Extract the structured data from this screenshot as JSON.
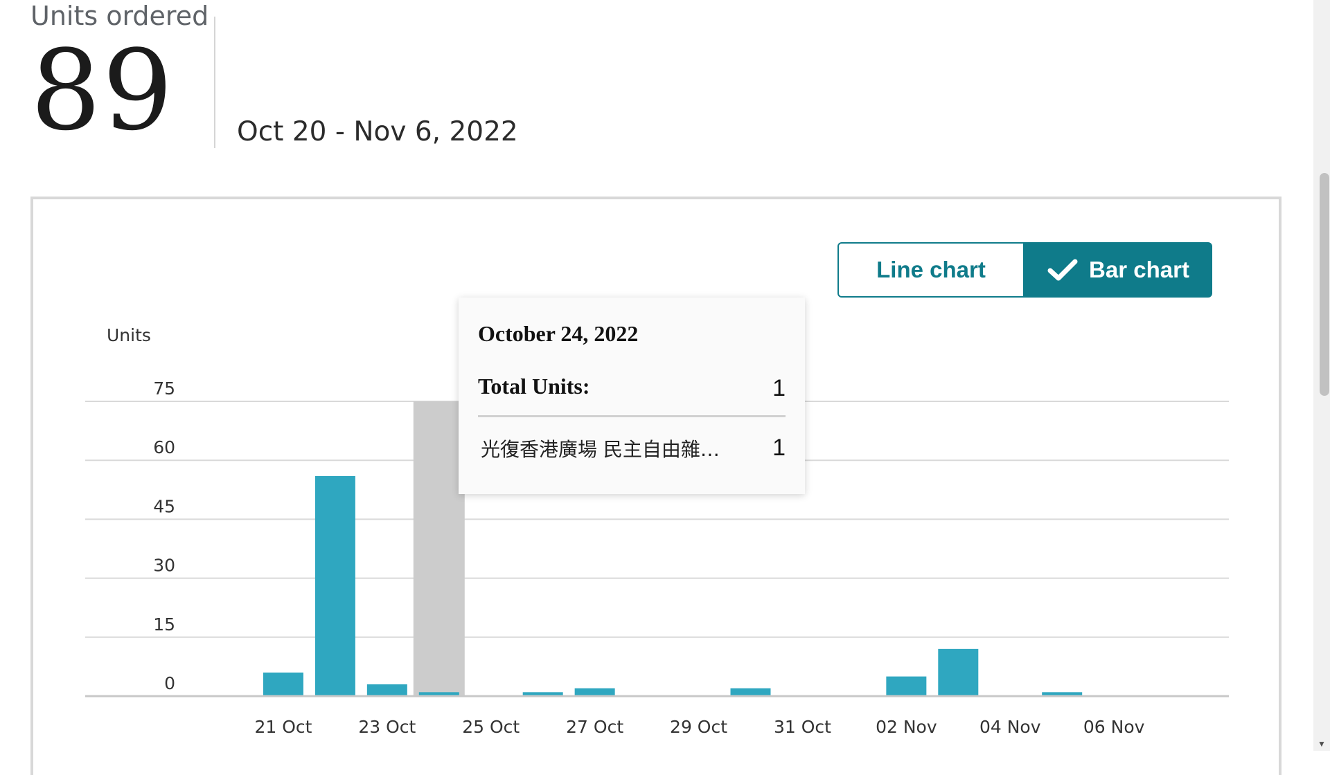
{
  "header": {
    "metric_label": "Units ordered",
    "metric_value": "89",
    "date_range": "Oct 20 - Nov 6, 2022"
  },
  "toggle": {
    "line_label": "Line chart",
    "bar_label": "Bar chart",
    "selected": "bar"
  },
  "tooltip": {
    "date": "October 24, 2022",
    "total_label": "Total Units:",
    "total_value": "1",
    "item_label": "光復香港廣場 民主自由雜…",
    "item_value": "1"
  },
  "colors": {
    "bar": "#2fa7c0",
    "highlight": "#cccccc",
    "accent": "#0f7b8a",
    "grid": "#d9d9d9"
  },
  "chart_data": {
    "type": "bar",
    "ylabel": "Units",
    "ylim": [
      0,
      75
    ],
    "yticks": [
      0,
      15,
      30,
      45,
      60,
      75
    ],
    "categories": [
      "20 Oct",
      "21 Oct",
      "22 Oct",
      "23 Oct",
      "24 Oct",
      "25 Oct",
      "26 Oct",
      "27 Oct",
      "28 Oct",
      "29 Oct",
      "30 Oct",
      "31 Oct",
      "01 Nov",
      "02 Nov",
      "03 Nov",
      "04 Nov",
      "05 Nov",
      "06 Nov"
    ],
    "x_tick_labels": [
      "21 Oct",
      "23 Oct",
      "25 Oct",
      "27 Oct",
      "29 Oct",
      "31 Oct",
      "02 Nov",
      "04 Nov",
      "06 Nov"
    ],
    "values": [
      0,
      6,
      56,
      3,
      1,
      0,
      1,
      2,
      0,
      0,
      2,
      0,
      0,
      5,
      12,
      0,
      1,
      0
    ],
    "highlighted_category": "24 Oct",
    "grid": true
  }
}
